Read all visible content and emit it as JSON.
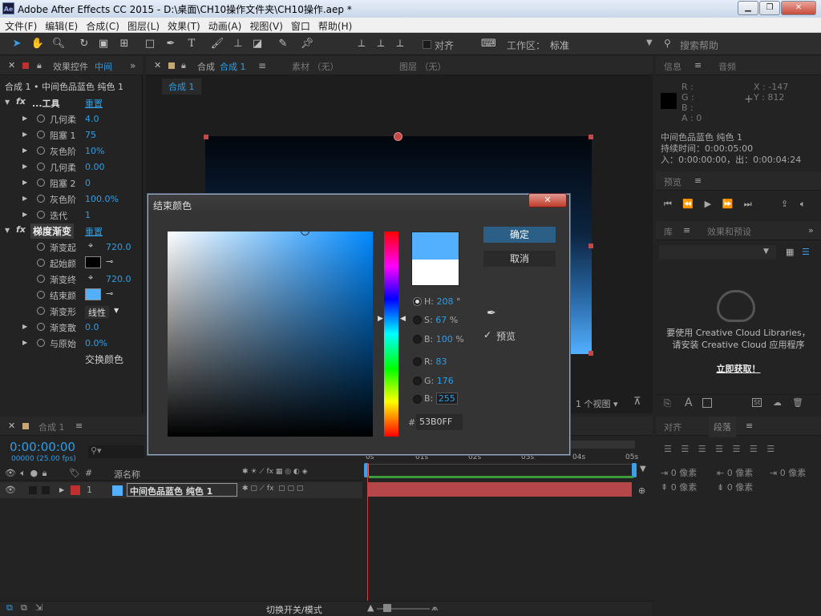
{
  "titlebar": {
    "logo": "Ae",
    "title": "Adobe After Effects CC 2015 - D:\\桌面\\CH10操作文件夹\\CH10操作.aep *",
    "minimize_icon": "minimize-icon",
    "restore_icon": "restore-icon",
    "close_icon": "close-icon"
  },
  "menu": [
    "文件(F)",
    "编辑(E)",
    "合成(C)",
    "图层(L)",
    "效果(T)",
    "动画(A)",
    "视图(V)",
    "窗口",
    "帮助(H)"
  ],
  "toolbar": {
    "align_label": "对齐",
    "workspace_label": "工作区：",
    "workspace_value": "标准",
    "search_placeholder": "搜索帮助"
  },
  "effects_panel": {
    "tab_label": "效果控件",
    "tab_comp": "中间",
    "header": "合成 1 • 中间色品蓝色 纯色 1",
    "group1": {
      "name": "...工具",
      "reset": "重置"
    },
    "rows1": [
      {
        "label": "几何柔",
        "value": "4.0"
      },
      {
        "label": "阻塞 1",
        "value": "75"
      },
      {
        "label": "灰色阶",
        "value": "10%"
      },
      {
        "label": "几何柔",
        "value": "0.00"
      },
      {
        "label": "阻塞 2",
        "value": "0"
      },
      {
        "label": "灰色阶",
        "value": "100.0%"
      },
      {
        "label": "迭代",
        "value": "1"
      }
    ],
    "group2": {
      "name": "梯度渐变",
      "reset": "重置"
    },
    "rows2": [
      {
        "label": "渐变起",
        "value": "720.0"
      },
      {
        "label": "起始颜",
        "value": ""
      },
      {
        "label": "渐变终",
        "value": "720.0"
      },
      {
        "label": "结束颜",
        "value": ""
      },
      {
        "label": "渐变形",
        "value": "线性"
      },
      {
        "label": "渐变散",
        "value": "0.0"
      },
      {
        "label": "与原始",
        "value": "0.0%"
      }
    ],
    "swap_label": "交换颜色"
  },
  "comp_panel": {
    "tab_comp_prefix": "合成",
    "tab_comp_name": "合成 1",
    "tab_footage": "素材 （无）",
    "tab_layer": "图层 （无）",
    "breadcrumb": "合成 1",
    "view_select": "1 个视图"
  },
  "info_panel": {
    "tab_info": "信息",
    "tab_audio": "音频",
    "r": "R :",
    "g": "G :",
    "b": "B :",
    "a": "A : 0",
    "x": "X : -147",
    "y": "Y : 812",
    "layer_name": "中间色品蓝色 纯色 1",
    "duration": "持续时间：0:00:05:00",
    "inout": "入：0:00:00:00，出：0:00:04:24"
  },
  "preview_panel": {
    "tab": "预览"
  },
  "library_panel": {
    "tab_lib": "库",
    "tab_effects": "效果和预设",
    "msg1": "要使用 Creative Cloud Libraries，",
    "msg2": "请安装 Creative Cloud 应用程序",
    "link": "立即获取！"
  },
  "align_panel": {
    "tab_align": "对齐",
    "tab_paragraph": "段落",
    "indent1": "0 像素",
    "indent2": "0 像素",
    "indent3": "0 像素",
    "space1": "0 像素",
    "space2": "0 像素"
  },
  "timeline": {
    "tab": "合成 1",
    "timecode": "0:00:00:00",
    "fps": "00000 (25.00 fps)",
    "col_num": "#",
    "col_source": "源名称",
    "layer_num": "1",
    "layer_name": "中间色品蓝色 纯色 1",
    "ruler": [
      "0s",
      "01s",
      "02s",
      "03s",
      "04s",
      "05s"
    ],
    "switch_mode": "切换开关/模式"
  },
  "dialog": {
    "title": "结束颜色",
    "ok": "确定",
    "cancel": "取消",
    "preview_label": "预览",
    "h_label": "H:",
    "h_value": "208",
    "h_unit": "°",
    "s_label": "S:",
    "s_value": "67",
    "s_unit": "%",
    "b_label": "B:",
    "b_value": "100",
    "b_unit": "%",
    "r_label": "R:",
    "r_value": "83",
    "g_label": "G:",
    "g_value": "176",
    "bb_label": "B:",
    "bb_value": "255",
    "hex_label": "#",
    "hex_value": "53B0FF",
    "new_color": "#53b0ff",
    "old_color": "#ffffff"
  },
  "colors": {
    "accent": "#2d9de6",
    "end_color": "#53b0ff",
    "start_color": "#000000",
    "layer_bar": "#b5474b"
  }
}
